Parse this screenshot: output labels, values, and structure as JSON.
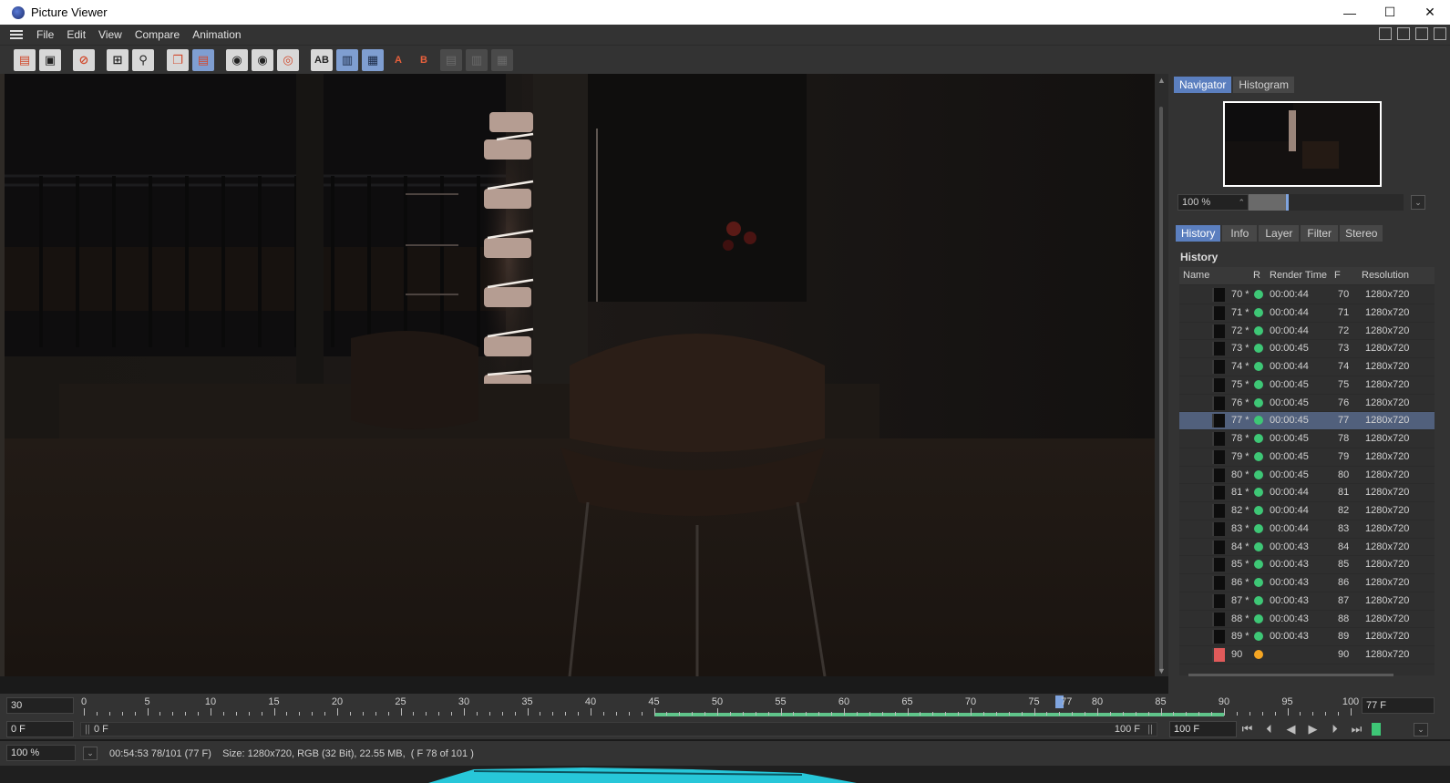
{
  "window": {
    "title": "Picture Viewer",
    "controls": [
      "—",
      "☐",
      "✕"
    ]
  },
  "menu": [
    "File",
    "Edit",
    "View",
    "Compare",
    "Animation"
  ],
  "toolbar": {
    "ab_label": "AB",
    "a_label": "A",
    "b_label": "B"
  },
  "navigator": {
    "tabs": [
      "Navigator",
      "Histogram"
    ],
    "active_tab": "Navigator",
    "zoom": "100 %",
    "zoom_arrow": "⌃",
    "dropdown": "⌄"
  },
  "panel_tabs": {
    "items": [
      "History",
      "Info",
      "Layer",
      "Filter",
      "Stereo"
    ],
    "active": "History"
  },
  "history": {
    "title": "History",
    "columns": {
      "name": "Name",
      "r": "R",
      "render_time": "Render Time",
      "f": "F",
      "resolution": "Resolution"
    },
    "rows": [
      {
        "num": "70 *",
        "status": "green",
        "time": "00:00:44",
        "frame": "70",
        "res": "1280x720"
      },
      {
        "num": "71 *",
        "status": "green",
        "time": "00:00:44",
        "frame": "71",
        "res": "1280x720"
      },
      {
        "num": "72 *",
        "status": "green",
        "time": "00:00:44",
        "frame": "72",
        "res": "1280x720"
      },
      {
        "num": "73 *",
        "status": "green",
        "time": "00:00:45",
        "frame": "73",
        "res": "1280x720"
      },
      {
        "num": "74 *",
        "status": "green",
        "time": "00:00:44",
        "frame": "74",
        "res": "1280x720"
      },
      {
        "num": "75 *",
        "status": "green",
        "time": "00:00:45",
        "frame": "75",
        "res": "1280x720"
      },
      {
        "num": "76 *",
        "status": "green",
        "time": "00:00:45",
        "frame": "76",
        "res": "1280x720"
      },
      {
        "num": "77 *",
        "status": "green",
        "time": "00:00:45",
        "frame": "77",
        "res": "1280x720",
        "selected": true
      },
      {
        "num": "78 *",
        "status": "green",
        "time": "00:00:45",
        "frame": "78",
        "res": "1280x720"
      },
      {
        "num": "79 *",
        "status": "green",
        "time": "00:00:45",
        "frame": "79",
        "res": "1280x720"
      },
      {
        "num": "80 *",
        "status": "green",
        "time": "00:00:45",
        "frame": "80",
        "res": "1280x720"
      },
      {
        "num": "81 *",
        "status": "green",
        "time": "00:00:44",
        "frame": "81",
        "res": "1280x720"
      },
      {
        "num": "82 *",
        "status": "green",
        "time": "00:00:44",
        "frame": "82",
        "res": "1280x720"
      },
      {
        "num": "83 *",
        "status": "green",
        "time": "00:00:44",
        "frame": "83",
        "res": "1280x720"
      },
      {
        "num": "84 *",
        "status": "green",
        "time": "00:00:43",
        "frame": "84",
        "res": "1280x720"
      },
      {
        "num": "85 *",
        "status": "green",
        "time": "00:00:43",
        "frame": "85",
        "res": "1280x720"
      },
      {
        "num": "86 *",
        "status": "green",
        "time": "00:00:43",
        "frame": "86",
        "res": "1280x720"
      },
      {
        "num": "87 *",
        "status": "green",
        "time": "00:00:43",
        "frame": "87",
        "res": "1280x720"
      },
      {
        "num": "88 *",
        "status": "green",
        "time": "00:00:43",
        "frame": "88",
        "res": "1280x720"
      },
      {
        "num": "89 *",
        "status": "green",
        "time": "00:00:43",
        "frame": "89",
        "res": "1280x720"
      },
      {
        "num": "90",
        "status": "orange",
        "time": "",
        "frame": "90",
        "res": "1280x720",
        "rendering": true
      }
    ]
  },
  "timeline": {
    "fps": "30",
    "ruler_labels": [
      "0",
      "5",
      "10",
      "15",
      "20",
      "25",
      "30",
      "35",
      "40",
      "45",
      "50",
      "55",
      "60",
      "65",
      "70",
      "75",
      "77",
      "80",
      "85",
      "90",
      "95",
      "100"
    ],
    "current_frame": 77,
    "cached_from": 45,
    "cached_to": 90,
    "end_value": "77 F",
    "start_field": "0 F",
    "range_start": "0 F",
    "range_end": "100 F",
    "end_field": "100 F"
  },
  "transport": [
    "⏮",
    "⏴",
    "◀",
    "▶",
    "⏵",
    "⏭"
  ],
  "status": {
    "zoom": "100 %",
    "info": "00:54:53 78/101 (77 F)    Size: 1280x720, RGB (32 Bit), 22.55 MB,  ( F 78 of 101 )"
  },
  "colors": {
    "accent": "#5b7fbf",
    "cached": "#5fc48a",
    "rendered": "#3ec776",
    "rendering": "#f5a623"
  }
}
